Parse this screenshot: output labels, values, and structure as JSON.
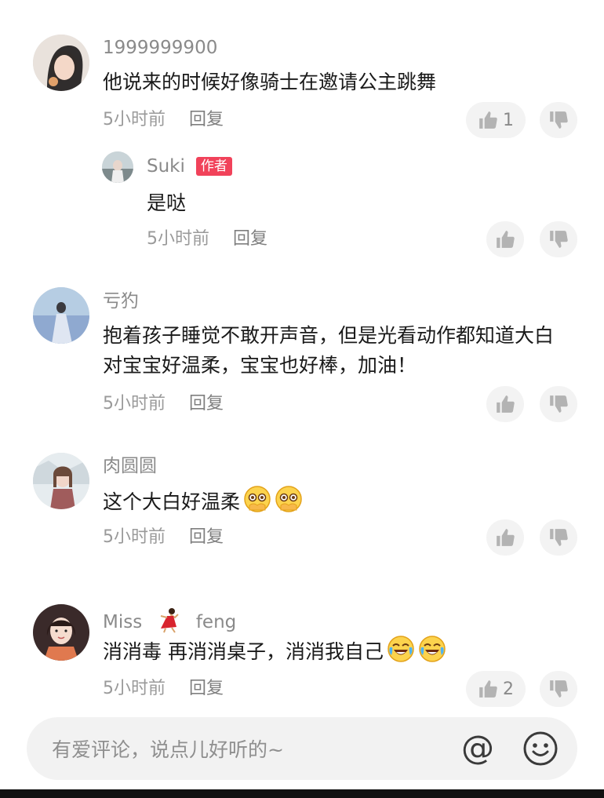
{
  "comments": [
    {
      "username": "1999999900",
      "text": "他说来的时候好像骑士在邀请公主跳舞",
      "time": "5小时前",
      "reply_label": "回复",
      "like_count": "1",
      "avatar_icon": "user-avatar-photo"
    },
    {
      "username": "Suki",
      "author_badge": "作者",
      "text": "是哒",
      "time": "5小时前",
      "reply_label": "回复",
      "avatar_icon": "user-avatar-photo"
    },
    {
      "username": "亏犳",
      "text": "抱着孩子睡觉不敢开声音，但是光看动作都知道大白对宝宝好温柔，宝宝也好棒，加油！",
      "time": "5小时前",
      "reply_label": "回复",
      "avatar_icon": "user-avatar-photo"
    },
    {
      "username": "肉圆圆",
      "text": "这个大白好温柔",
      "emojis": [
        "pleading-face-emoji",
        "pleading-face-emoji"
      ],
      "time": "5小时前",
      "reply_label": "回复",
      "avatar_icon": "user-avatar-photo"
    },
    {
      "username_part1": "Miss",
      "username_part2": "feng",
      "username_emoji": "dancer-emoji",
      "text": "消消毒 再消消桌子，消消我自己",
      "emojis": [
        "rolling-laughing-emoji",
        "rolling-laughing-emoji"
      ],
      "time": "5小时前",
      "reply_label": "回复",
      "like_count": "2",
      "avatar_icon": "user-avatar-photo"
    }
  ],
  "input_bar": {
    "placeholder": "有爱评论，说点儿好听的~",
    "at_symbol": "@",
    "emoji_icon": "smiley-face-icon"
  },
  "colors": {
    "author_badge": "#f1425a",
    "pill_bg": "#f3f3f3",
    "meta_text": "#9a9a9a"
  }
}
